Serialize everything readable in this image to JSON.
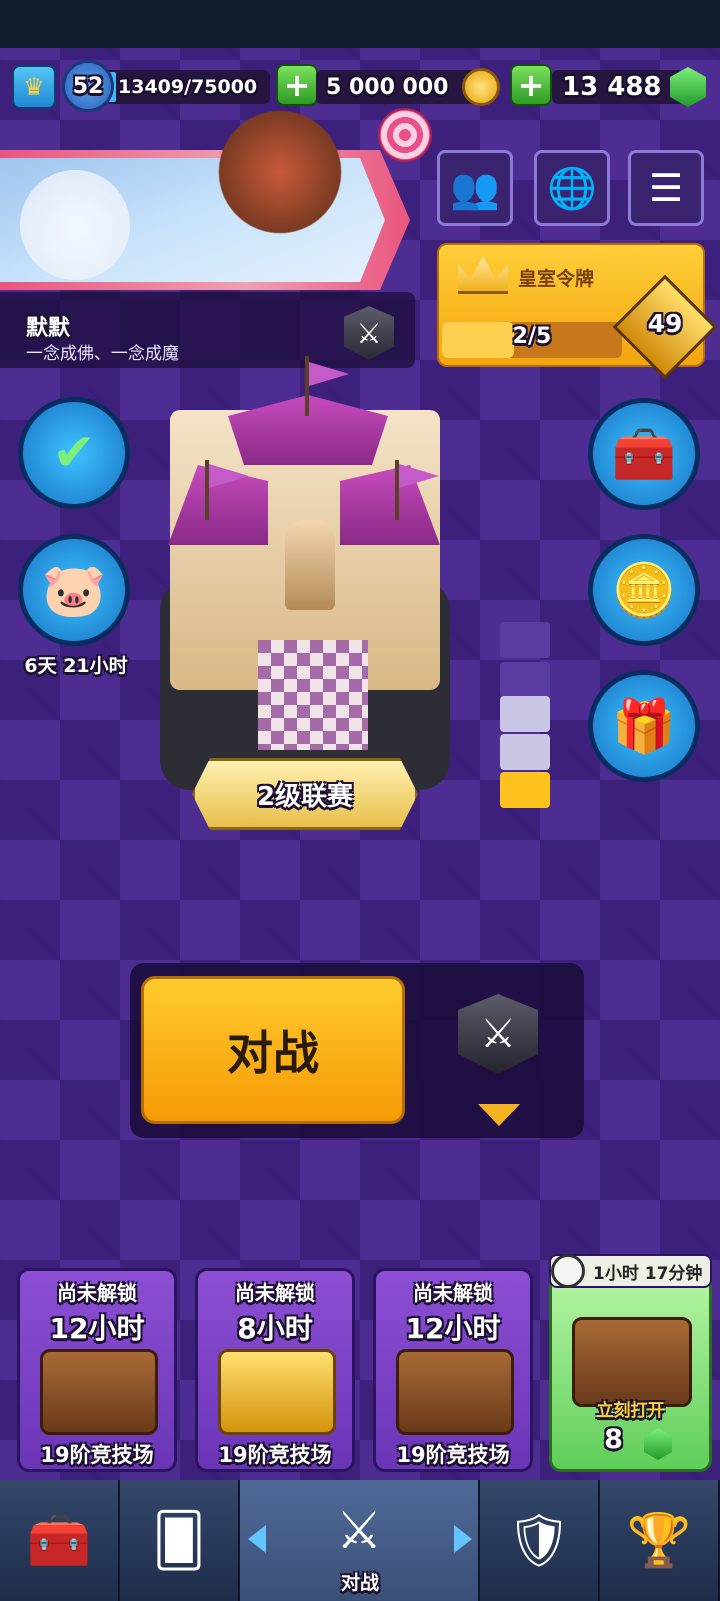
{
  "resources": {
    "level": "52",
    "xp": "13409/75000",
    "gold": "5 000 000",
    "gems": "13 488"
  },
  "player": {
    "name": "默默",
    "clan": "一念成佛、一念成魔"
  },
  "royal_pass": {
    "label": "皇室令牌",
    "progress_text": "2/5",
    "progress": 0.4,
    "level": "49"
  },
  "piggy_bank": {
    "timer": "6天 21小时"
  },
  "arena": {
    "league": "2级联赛"
  },
  "battle": {
    "label": "对战"
  },
  "chests": [
    {
      "status": "尚未解锁",
      "time": "12小时",
      "arena": "19阶竞技场",
      "icon": "wooden-chest-icon"
    },
    {
      "status": "尚未解锁",
      "time": "8小时",
      "arena": "19阶竞技场",
      "icon": "golden-chest-icon"
    },
    {
      "status": "尚未解锁",
      "time": "12小时",
      "arena": "19阶竞技场",
      "icon": "wooden-chest-icon"
    }
  ],
  "ready_chest": {
    "timer": "1小时 17分钟",
    "open_now": "立刻打开",
    "gem_cost": "8"
  },
  "nav": {
    "active_label": "对战",
    "tabs": [
      "shop-icon",
      "cards-icon",
      "battle-icon",
      "clan-icon",
      "events-icon"
    ]
  },
  "colors": {
    "background": "#4d2d92",
    "battle_button": "#f5a50a",
    "accent_blue": "#1f87d4",
    "gem_green": "#2faf38"
  }
}
